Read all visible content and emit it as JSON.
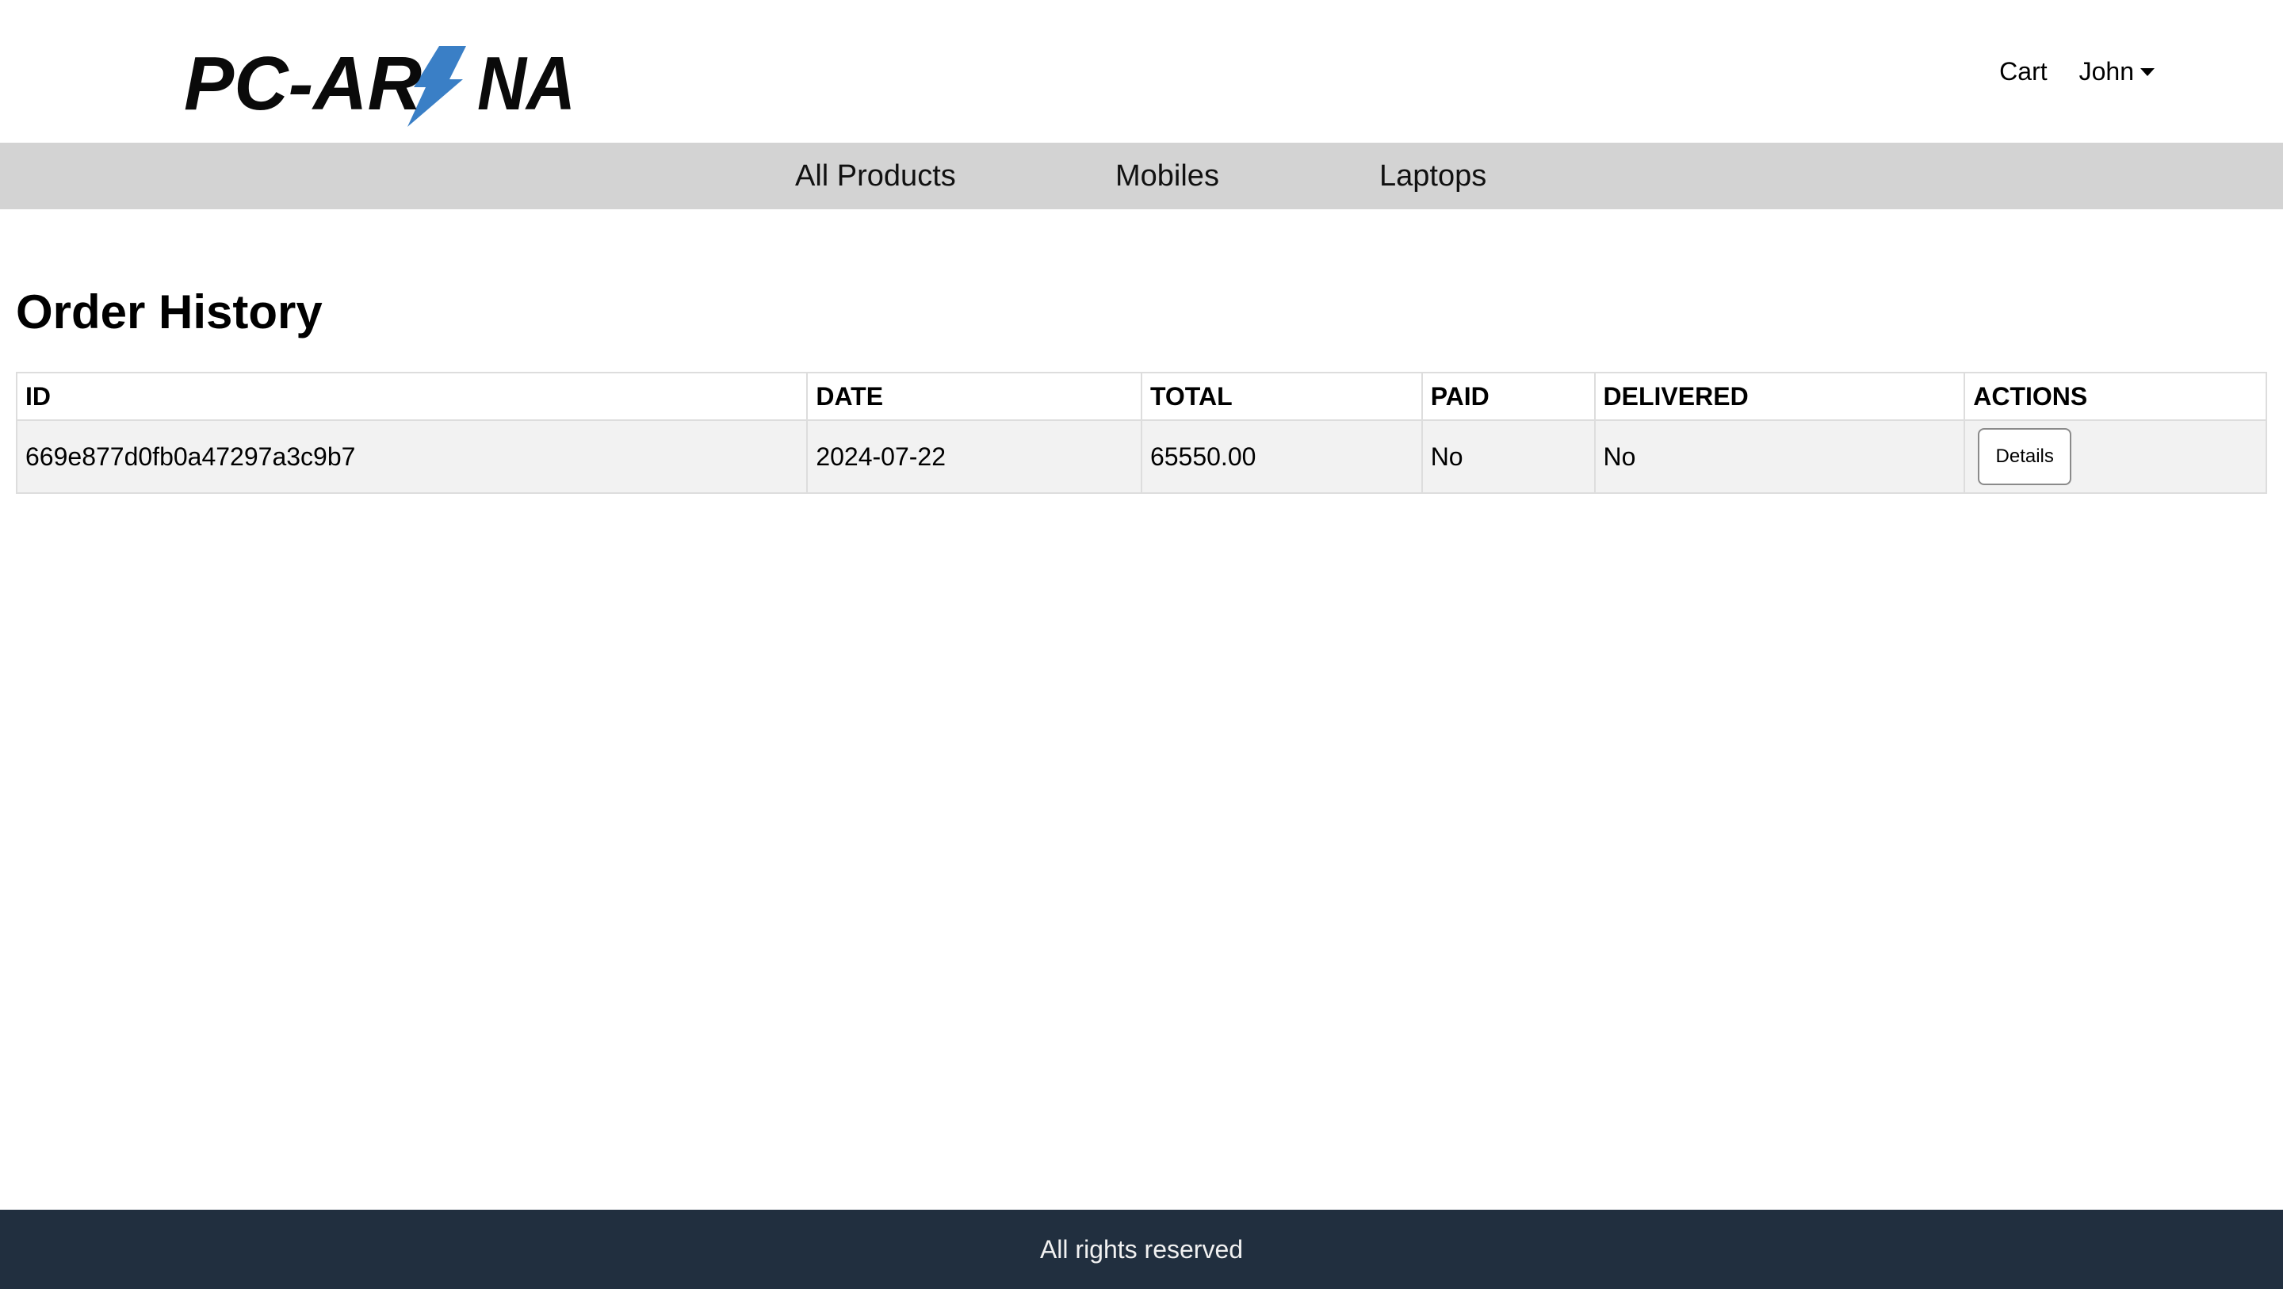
{
  "header": {
    "logo_text": "PC-ARENA",
    "logo_accent_color": "#3a7fc6",
    "cart_label": "Cart",
    "user_name": "John"
  },
  "nav": {
    "items": [
      {
        "label": "All Products"
      },
      {
        "label": "Mobiles"
      },
      {
        "label": "Laptops"
      }
    ],
    "background": "#d3d3d3"
  },
  "main": {
    "title": "Order History",
    "table": {
      "columns": [
        "ID",
        "DATE",
        "TOTAL",
        "PAID",
        "DELIVERED",
        "ACTIONS"
      ],
      "rows": [
        {
          "id": "669e877d0fb0a47297a3c9b7",
          "date": "2024-07-22",
          "total": "65550.00",
          "paid": "No",
          "delivered": "No",
          "action_label": "Details"
        }
      ]
    }
  },
  "footer": {
    "text": "All rights reserved",
    "background": "#212f3f"
  }
}
